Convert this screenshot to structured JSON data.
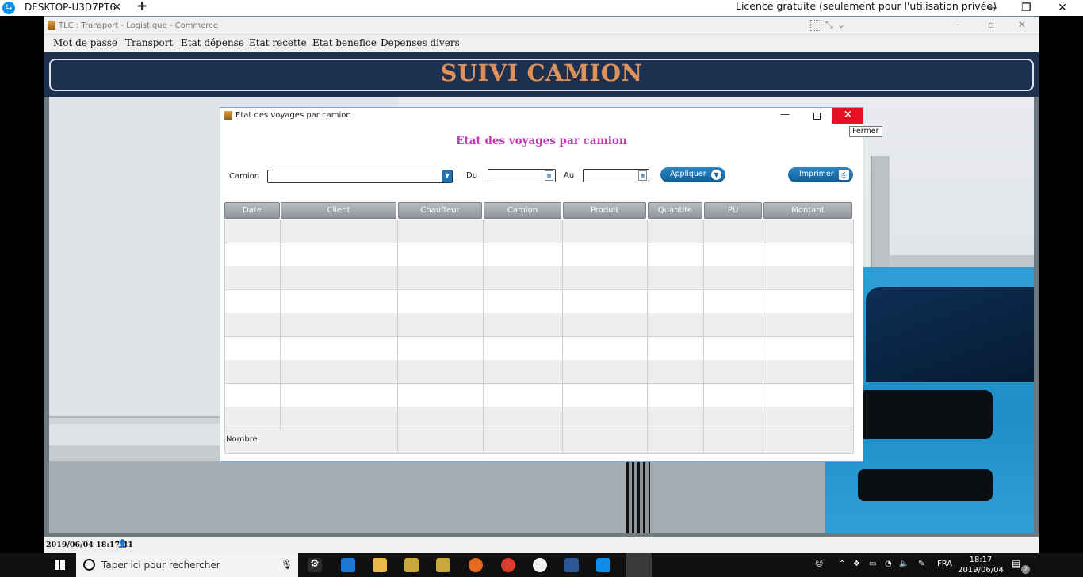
{
  "teamviewer": {
    "tab_title": "DESKTOP-U3D7PT6",
    "tab_close": "✕",
    "new_tab": "+",
    "license": "Licence gratuite (seulement pour l'utilisation privée)",
    "minimize": "—",
    "restore": "❐",
    "close": "✕"
  },
  "app": {
    "window_title": "TLC : Transport - Logistique - Commerce",
    "menu": [
      "Mot de passe",
      "Transport",
      "Etat dépense",
      "Etat recette",
      "Etat benefice",
      "Depenses divers"
    ],
    "banner_title": "SUIVI CAMION",
    "status_text": "2019/06/04  18:17:41"
  },
  "dialog": {
    "title": "Etat des voyages par camion",
    "heading": "Etat des voyages par camion",
    "close_tooltip": "Fermer",
    "filters": {
      "camion_label": "Camion",
      "camion_value": "",
      "du_label": "Du",
      "du_value": "",
      "au_label": "Au",
      "au_value": "",
      "apply_label": "Appliquer",
      "print_label": "Imprimer"
    },
    "table": {
      "columns": [
        "Date",
        "Client",
        "Chauffeur",
        "Camion",
        "Produit",
        "Quantite",
        "PU",
        "Montant"
      ],
      "rows": 9,
      "footer_label": "Nombre"
    }
  },
  "taskbar": {
    "search_placeholder": "Taper ici pour rechercher",
    "language": "FRA",
    "time": "18:17",
    "date": "2019/06/04",
    "notifications": "2"
  }
}
